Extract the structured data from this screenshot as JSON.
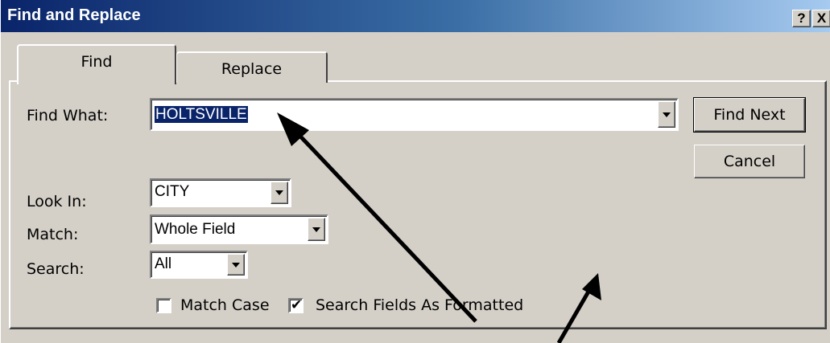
{
  "window": {
    "title": "Find and Replace",
    "help_button": "?",
    "close_button": "X"
  },
  "tabs": [
    {
      "label": "Find",
      "active": true
    },
    {
      "label": "Replace",
      "active": false
    }
  ],
  "find_what": {
    "label": "Find What:",
    "value": "HOLTSVILLE",
    "selected": true
  },
  "look_in": {
    "label": "Look In:",
    "value": "CITY"
  },
  "match": {
    "label": "Match:",
    "value": "Whole Field"
  },
  "search": {
    "label": "Search:",
    "value": "All"
  },
  "buttons": {
    "find_next": "Find Next",
    "cancel": "Cancel"
  },
  "options": {
    "match_case": {
      "label": "Match Case",
      "checked": false
    },
    "search_fields_as_formatted": {
      "label": "Search Fields As Formatted",
      "checked": true
    }
  },
  "colors": {
    "dialog_face": "#d4d0c8",
    "title_gradient_start": "#0a246a",
    "title_gradient_end": "#a6caf0",
    "selection": "#0a246a"
  },
  "annotations": [
    {
      "type": "arrow",
      "points_to": "find-what-input"
    },
    {
      "type": "arrow",
      "points_to": "search-fields-as-formatted-checkbox"
    }
  ]
}
